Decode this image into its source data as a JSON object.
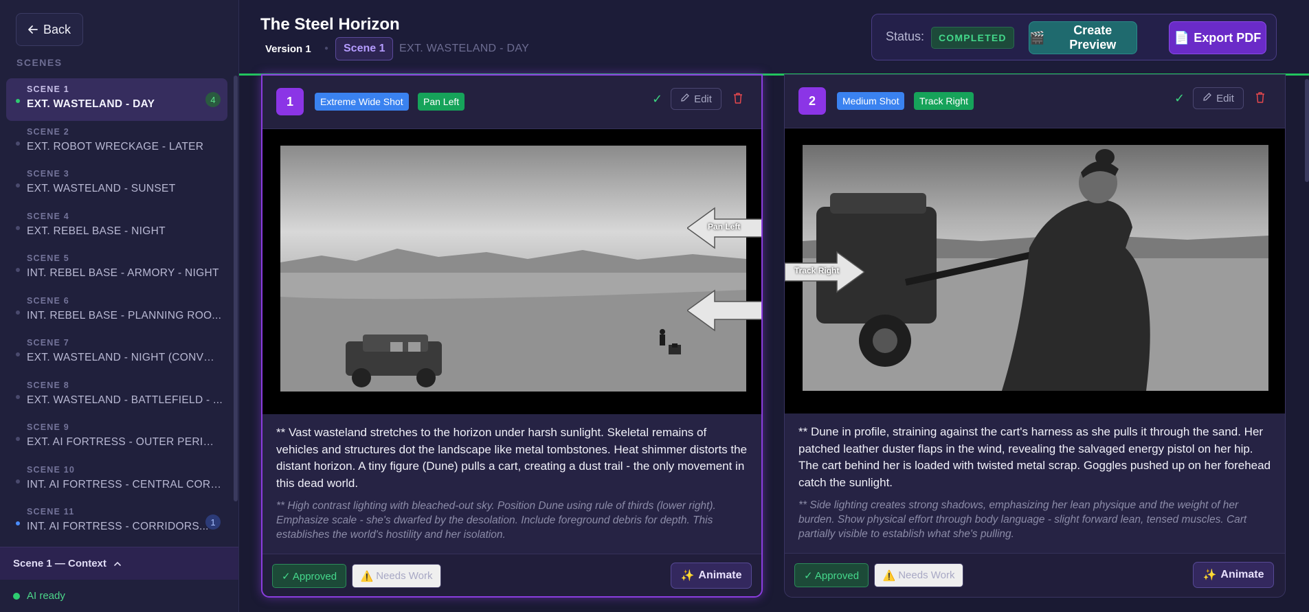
{
  "sidebar": {
    "back_label": "Back",
    "section_label": "SCENES",
    "scenes": [
      {
        "num": "SCENE 1",
        "name": "EXT. WASTELAND - DAY",
        "count": "4"
      },
      {
        "num": "SCENE 2",
        "name": "EXT. ROBOT WRECKAGE - LATER"
      },
      {
        "num": "SCENE 3",
        "name": "EXT. WASTELAND - SUNSET"
      },
      {
        "num": "SCENE 4",
        "name": "EXT. REBEL BASE - NIGHT"
      },
      {
        "num": "SCENE 5",
        "name": "INT. REBEL BASE - ARMORY - NIGHT"
      },
      {
        "num": "SCENE 6",
        "name": "INT. REBEL BASE - PLANNING ROO..."
      },
      {
        "num": "SCENE 7",
        "name": "EXT. WASTELAND - NIGHT (CONVOY)"
      },
      {
        "num": "SCENE 8",
        "name": "EXT. WASTELAND - BATTLEFIELD - ..."
      },
      {
        "num": "SCENE 9",
        "name": "EXT. AI FORTRESS - OUTER PERIME..."
      },
      {
        "num": "SCENE 10",
        "name": "INT. AI FORTRESS - CENTRAL CORE ..."
      },
      {
        "num": "SCENE 11",
        "name": "INT. AI FORTRESS - CORRIDORS...",
        "count": "1"
      }
    ],
    "context_label": "Scene 1 — Context",
    "ai_status": "AI ready"
  },
  "header": {
    "title": "The Steel Horizon",
    "version_tab": "Version 1",
    "scene_pill": "Scene 1",
    "scene_heading": "EXT. WASTELAND - DAY",
    "status_label": "Status:",
    "status_value": "COMPLETED",
    "preview_label": "Create Preview",
    "export_label": "Export PDF"
  },
  "shots": [
    {
      "number": "1",
      "shot_type": "Extreme Wide Shot",
      "camera_move": "Pan Left",
      "edit_label": "Edit",
      "description": "** Vast wasteland stretches to the horizon under harsh sunlight. Skeletal remains of vehicles and structures dot the landscape like metal tombstones. Heat shimmer distorts the distant horizon. A tiny figure (Dune) pulls a cart, creating a dust trail - the only movement in this dead world.",
      "notes": "** High contrast lighting with bleached-out sky. Position Dune using rule of thirds (lower right). Emphasize scale - she's dwarfed by the desolation. Include foreground debris for depth. This establishes the world's hostility and her isolation.",
      "approved_label": "✓ Approved",
      "needs_work_label": "Needs Work",
      "animate_label": "Animate",
      "overlay_label": "Pan Left"
    },
    {
      "number": "2",
      "shot_type": "Medium Shot",
      "camera_move": "Track Right",
      "edit_label": "Edit",
      "description": "** Dune in profile, straining against the cart's harness as she pulls it through the sand. Her patched leather duster flaps in the wind, revealing the salvaged energy pistol on her hip. The cart behind her is loaded with twisted metal scrap. Goggles pushed up on her forehead catch the sunlight.",
      "notes": "** Side lighting creates strong shadows, emphasizing her lean physique and the weight of her burden. Show physical effort through body language - slight forward lean, tensed muscles. Cart partially visible to establish what she's pulling.",
      "approved_label": "✓ Approved",
      "needs_work_label": "Needs Work",
      "animate_label": "Animate",
      "overlay_label": "Track Right"
    }
  ],
  "colors": {
    "accent_purple": "#8b35e6",
    "success_green": "#22c55e",
    "tag_blue": "#3a82f0",
    "tag_green": "#16a35a"
  }
}
